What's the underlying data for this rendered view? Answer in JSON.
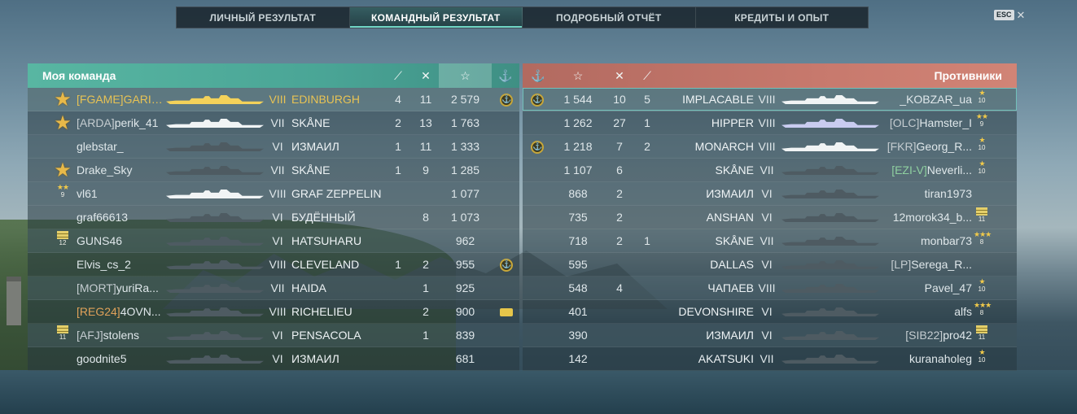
{
  "tabs": [
    {
      "label": "ЛИЧНЫЙ РЕЗУЛЬТАТ",
      "active": false
    },
    {
      "label": "КОМАНДНЫЙ РЕЗУЛЬТАТ",
      "active": true
    },
    {
      "label": "ПОДРОБНЫЙ ОТЧЁТ",
      "active": false
    },
    {
      "label": "КРЕДИТЫ И ОПЫТ",
      "active": false
    }
  ],
  "esc_label": "ESC",
  "close_symbol": "✕",
  "colors": {
    "team": "#58b6a2",
    "enemy": "#c7796d",
    "gold": "#e8c354"
  },
  "my_team": {
    "title": "Моя команда",
    "columns": {
      "damage_icon": "torpedo-icon",
      "kills_icon": "crossed-swords-icon",
      "xp_icon": "star-icon",
      "bonus_icon": "anchor-icon"
    },
    "rows": [
      {
        "clan": "[FGAME]",
        "name": "GARIC...",
        "tier": "VIII",
        "ship": "EDINBURGH",
        "c1": "4",
        "c2": "11",
        "xp": "2 579",
        "badge": "star",
        "bonus": "anchor",
        "gold": true
      },
      {
        "clan": "[ARDA]",
        "name": "perik_41",
        "tier": "VII",
        "ship": "SKÅNE",
        "c1": "2",
        "c2": "13",
        "xp": "1 763",
        "badge": "star",
        "bonus": ""
      },
      {
        "clan": "",
        "name": "glebstar_",
        "tier": "VI",
        "ship": "ИЗМАИЛ",
        "c1": "1",
        "c2": "11",
        "xp": "1 333",
        "badge": "",
        "bonus": ""
      },
      {
        "clan": "",
        "name": "Drake_Sky",
        "tier": "VII",
        "ship": "SKÅNE",
        "c1": "1",
        "c2": "9",
        "xp": "1 285",
        "badge": "star",
        "bonus": ""
      },
      {
        "clan": "",
        "name": "vl61",
        "tier": "VIII",
        "ship": "GRAF ZEPPELIN",
        "c1": "",
        "c2": "",
        "xp": "1 077",
        "badge": "rank",
        "rank": "9",
        "bonus": ""
      },
      {
        "clan": "",
        "name": "graf66613",
        "tier": "VI",
        "ship": "БУДЁННЫЙ",
        "c1": "",
        "c2": "8",
        "xp": "1 073",
        "badge": "",
        "bonus": ""
      },
      {
        "clan": "",
        "name": "GUNS46",
        "tier": "VI",
        "ship": "HATSUHARU",
        "c1": "",
        "c2": "",
        "xp": "962",
        "badge": "chev",
        "rank": "12",
        "bonus": ""
      },
      {
        "clan": "",
        "name": "Elvis_cs_2",
        "tier": "VIII",
        "ship": "CLEVELAND",
        "c1": "1",
        "c2": "2",
        "xp": "955",
        "badge": "",
        "bonus": "anchor"
      },
      {
        "clan": "[MORT]",
        "name": "yuriRa...",
        "tier": "VII",
        "ship": "HAIDA",
        "c1": "",
        "c2": "1",
        "xp": "925",
        "badge": "",
        "bonus": ""
      },
      {
        "clan": "[REG24]",
        "name": "4OVN...",
        "tier": "VIII",
        "ship": "RICHELIEU",
        "c1": "",
        "c2": "2",
        "xp": "900",
        "badge": "",
        "bonus": "tank"
      },
      {
        "clan": "[AFJ]",
        "name": "stolens",
        "tier": "VI",
        "ship": "PENSACOLA",
        "c1": "",
        "c2": "1",
        "xp": "839",
        "badge": "chev",
        "rank": "11",
        "bonus": ""
      },
      {
        "clan": "",
        "name": "goodnite5",
        "tier": "VI",
        "ship": "ИЗМАИЛ",
        "c1": "",
        "c2": "",
        "xp": "681",
        "badge": "",
        "bonus": ""
      }
    ]
  },
  "enemies": {
    "title": "Противники",
    "rows": [
      {
        "bonus": "anchor",
        "xp": "1 544",
        "c1": "10",
        "c2": "5",
        "ship": "IMPLACABLE",
        "tier": "VIII",
        "clan": "",
        "name": "_KOBZAR_ua",
        "badge": "rank",
        "rank": "10",
        "stars": "★"
      },
      {
        "bonus": "",
        "xp": "1 262",
        "c1": "27",
        "c2": "1",
        "ship": "HIPPER",
        "tier": "VIII",
        "clan": "[OLC]",
        "name": "Hamster_I",
        "badge": "rank",
        "rank": "9",
        "stars": "★★"
      },
      {
        "bonus": "anchor",
        "xp": "1 218",
        "c1": "7",
        "c2": "2",
        "ship": "MONARCH",
        "tier": "VIII",
        "clan": "[FKR]",
        "name": "Georg_R...",
        "badge": "rank",
        "rank": "10",
        "stars": "★"
      },
      {
        "bonus": "",
        "xp": "1 107",
        "c1": "6",
        "c2": "",
        "ship": "SKÅNE",
        "tier": "VII",
        "clan": "[EZI-V]",
        "name": "Neverli...",
        "badge": "rank",
        "rank": "10",
        "stars": "★"
      },
      {
        "bonus": "",
        "xp": "868",
        "c1": "2",
        "c2": "",
        "ship": "ИЗМАИЛ",
        "tier": "VI",
        "clan": "",
        "name": "tiran1973",
        "badge": "",
        "rank": "",
        "stars": ""
      },
      {
        "bonus": "",
        "xp": "735",
        "c1": "2",
        "c2": "",
        "ship": "ANSHAN",
        "tier": "VI",
        "clan": "",
        "name": "12morok34_b...",
        "badge": "chev",
        "rank": "11",
        "stars": ""
      },
      {
        "bonus": "",
        "xp": "718",
        "c1": "2",
        "c2": "1",
        "ship": "SKÅNE",
        "tier": "VII",
        "clan": "",
        "name": "monbar73",
        "badge": "rank",
        "rank": "8",
        "stars": "★★★"
      },
      {
        "bonus": "",
        "xp": "595",
        "c1": "",
        "c2": "",
        "ship": "DALLAS",
        "tier": "VI",
        "clan": "[LP]",
        "name": "Serega_R...",
        "badge": "",
        "rank": "",
        "stars": ""
      },
      {
        "bonus": "",
        "xp": "548",
        "c1": "4",
        "c2": "",
        "ship": "ЧАПАЕВ",
        "tier": "VIII",
        "clan": "",
        "name": "Pavel_47",
        "badge": "rank",
        "rank": "10",
        "stars": "★"
      },
      {
        "bonus": "",
        "xp": "401",
        "c1": "",
        "c2": "",
        "ship": "DEVONSHIRE",
        "tier": "VI",
        "clan": "",
        "name": "alfs",
        "badge": "rank",
        "rank": "8",
        "stars": "★★★"
      },
      {
        "bonus": "",
        "xp": "390",
        "c1": "",
        "c2": "",
        "ship": "ИЗМАИЛ",
        "tier": "VI",
        "clan": "[SIB22]",
        "name": "pro42",
        "badge": "chev",
        "rank": "11",
        "stars": ""
      },
      {
        "bonus": "",
        "xp": "142",
        "c1": "",
        "c2": "",
        "ship": "AKATSUKI",
        "tier": "VII",
        "clan": "",
        "name": "kuranaholeg",
        "badge": "rank",
        "rank": "10",
        "stars": "★"
      }
    ]
  }
}
